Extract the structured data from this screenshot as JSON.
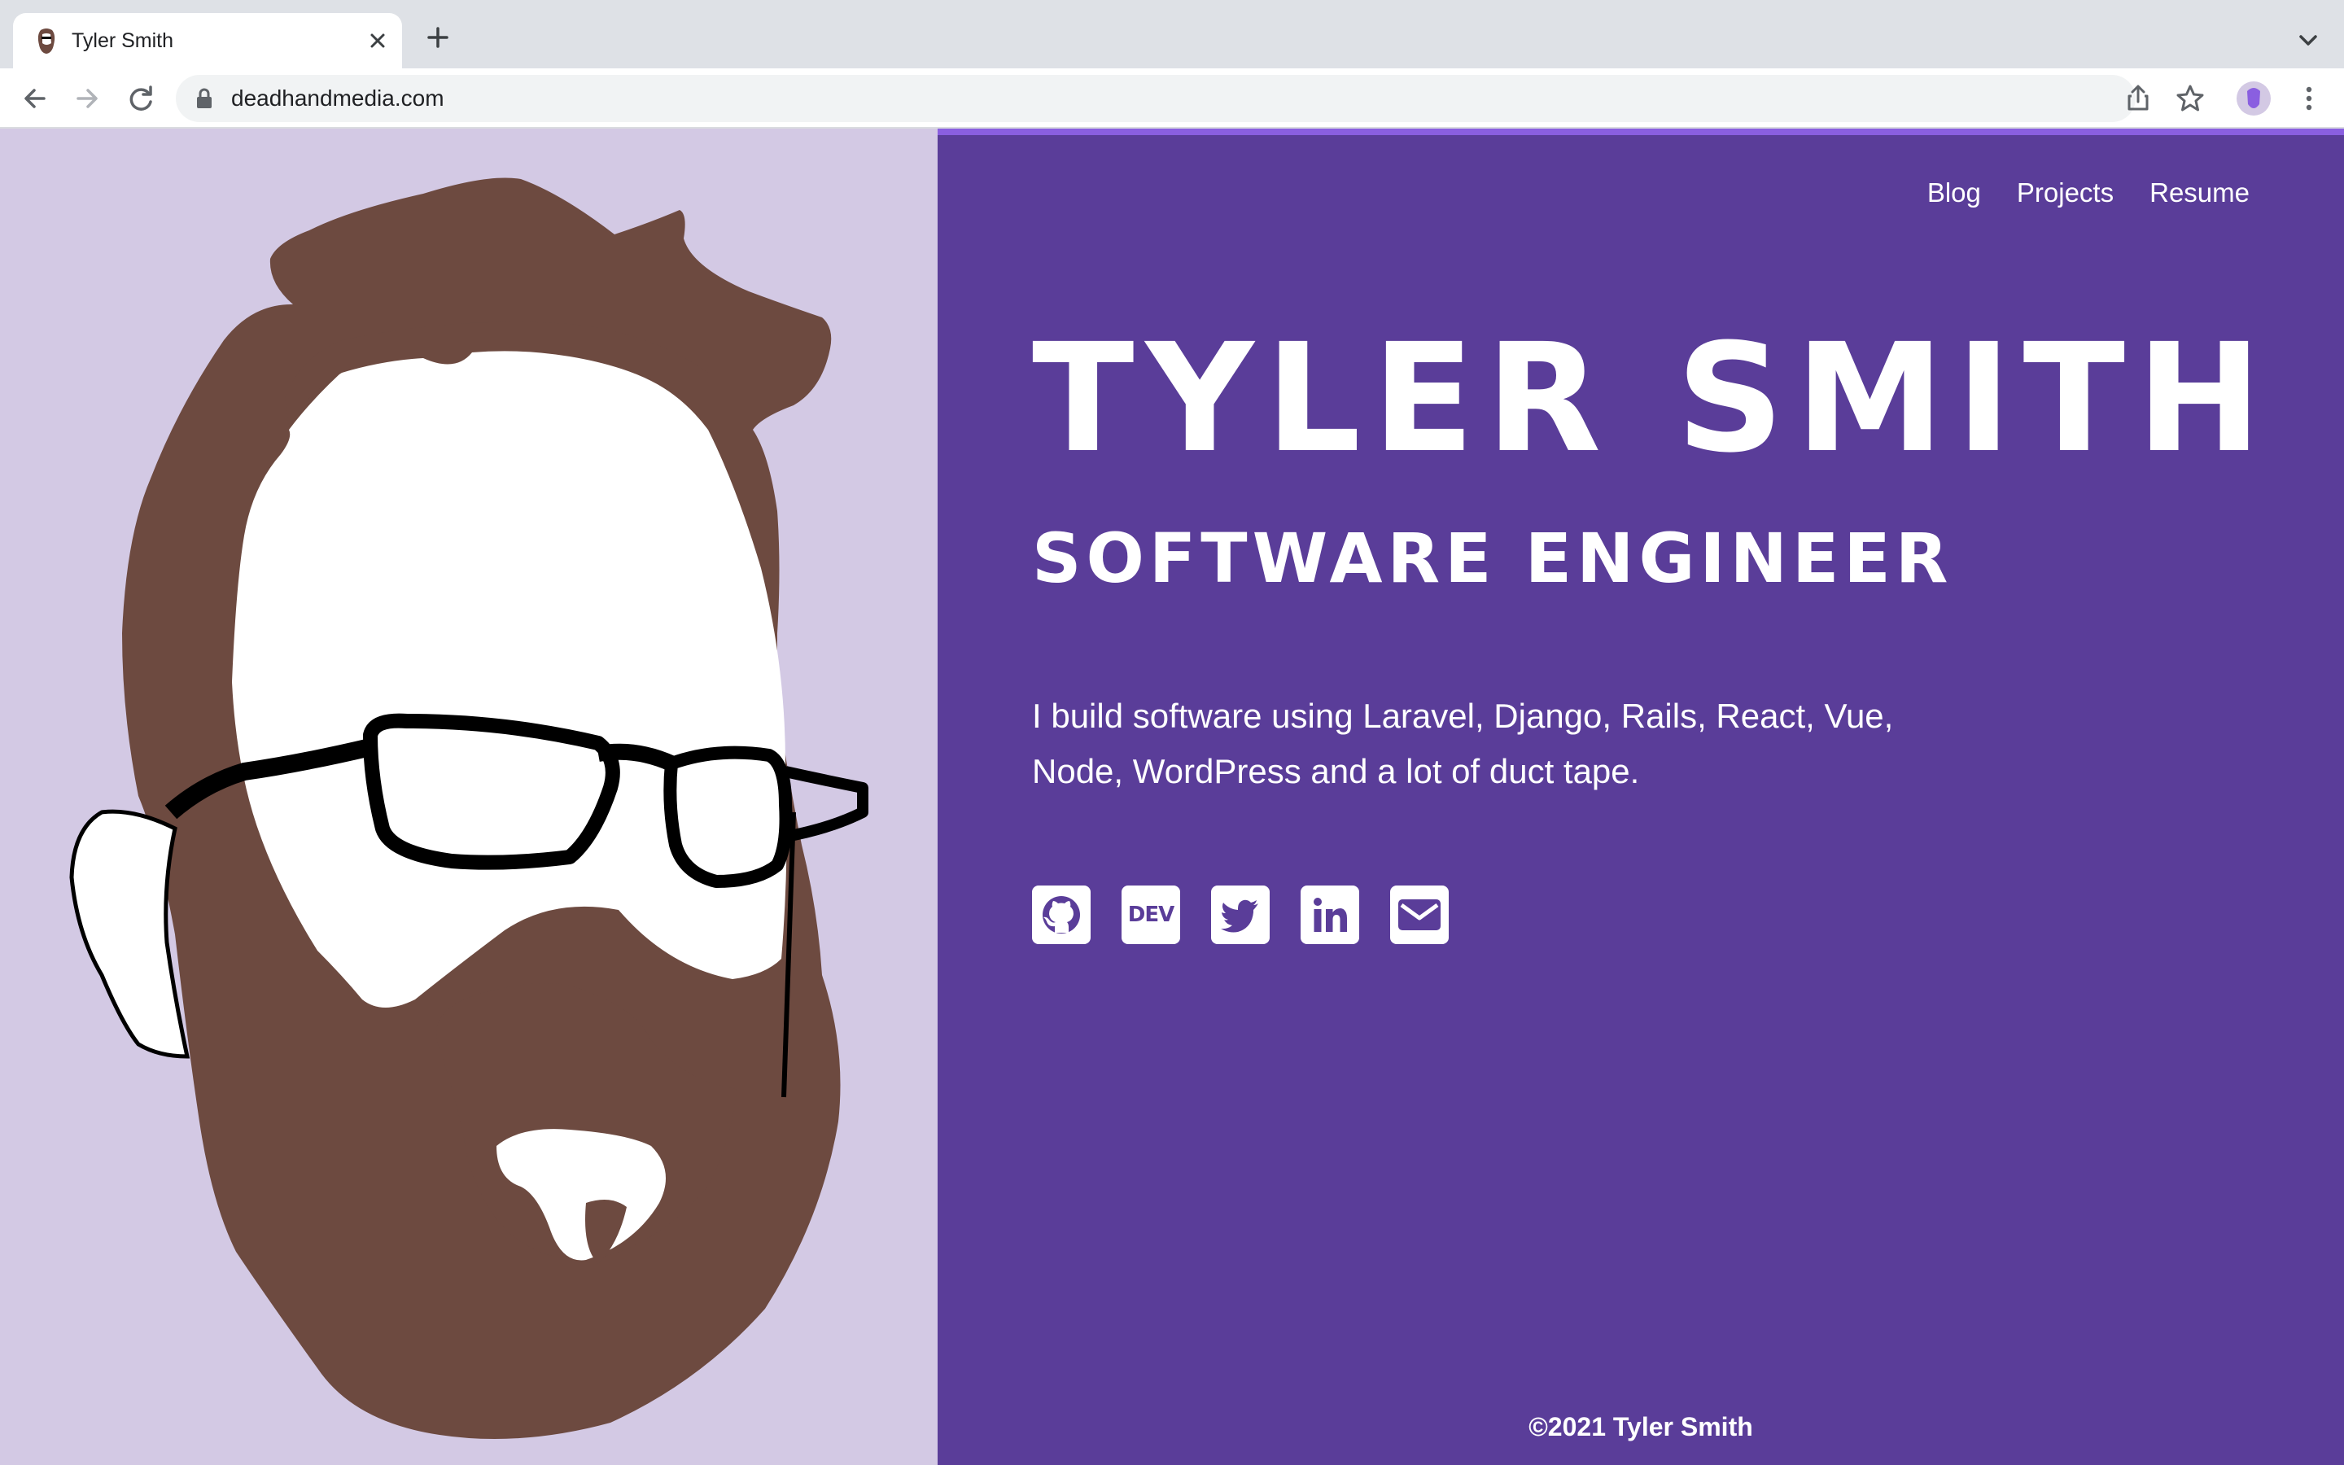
{
  "browser": {
    "tab": {
      "title": "Tyler Smith",
      "favicon": "portrait-favicon"
    },
    "address_bar": {
      "url": "deadhandmedia.com",
      "secure_icon": "lock-icon"
    },
    "icons": {
      "tab_close": "close-icon",
      "new_tab": "plus-icon",
      "tab_search": "chevron-down-icon",
      "back": "arrow-left-icon",
      "forward": "arrow-right-icon",
      "reload": "reload-icon",
      "share": "share-icon",
      "bookmark": "star-icon",
      "profile": "avatar",
      "menu": "kebab-menu-icon"
    }
  },
  "page": {
    "nav": {
      "items": [
        {
          "label": "Blog"
        },
        {
          "label": "Projects"
        },
        {
          "label": "Resume"
        }
      ]
    },
    "hero": {
      "name": "TYLER SMITH",
      "role": "SOFTWARE ENGINEER",
      "bio": "I build software using Laravel, Django, Rails, React, Vue, Node, WordPress and a lot of duct tape."
    },
    "social": [
      {
        "icon": "github-icon"
      },
      {
        "icon": "dev-icon",
        "text": "DEV"
      },
      {
        "icon": "twitter-icon"
      },
      {
        "icon": "linkedin-icon"
      },
      {
        "icon": "email-icon"
      }
    ],
    "footer": {
      "text": "©2021 Tyler Smith"
    },
    "colors": {
      "left_background": "#d3c9e4",
      "right_background": "#5a3d99",
      "accent_bar": "#8a5fe0",
      "hair_beard": "#6d4a40",
      "text": "#ffffff"
    }
  }
}
